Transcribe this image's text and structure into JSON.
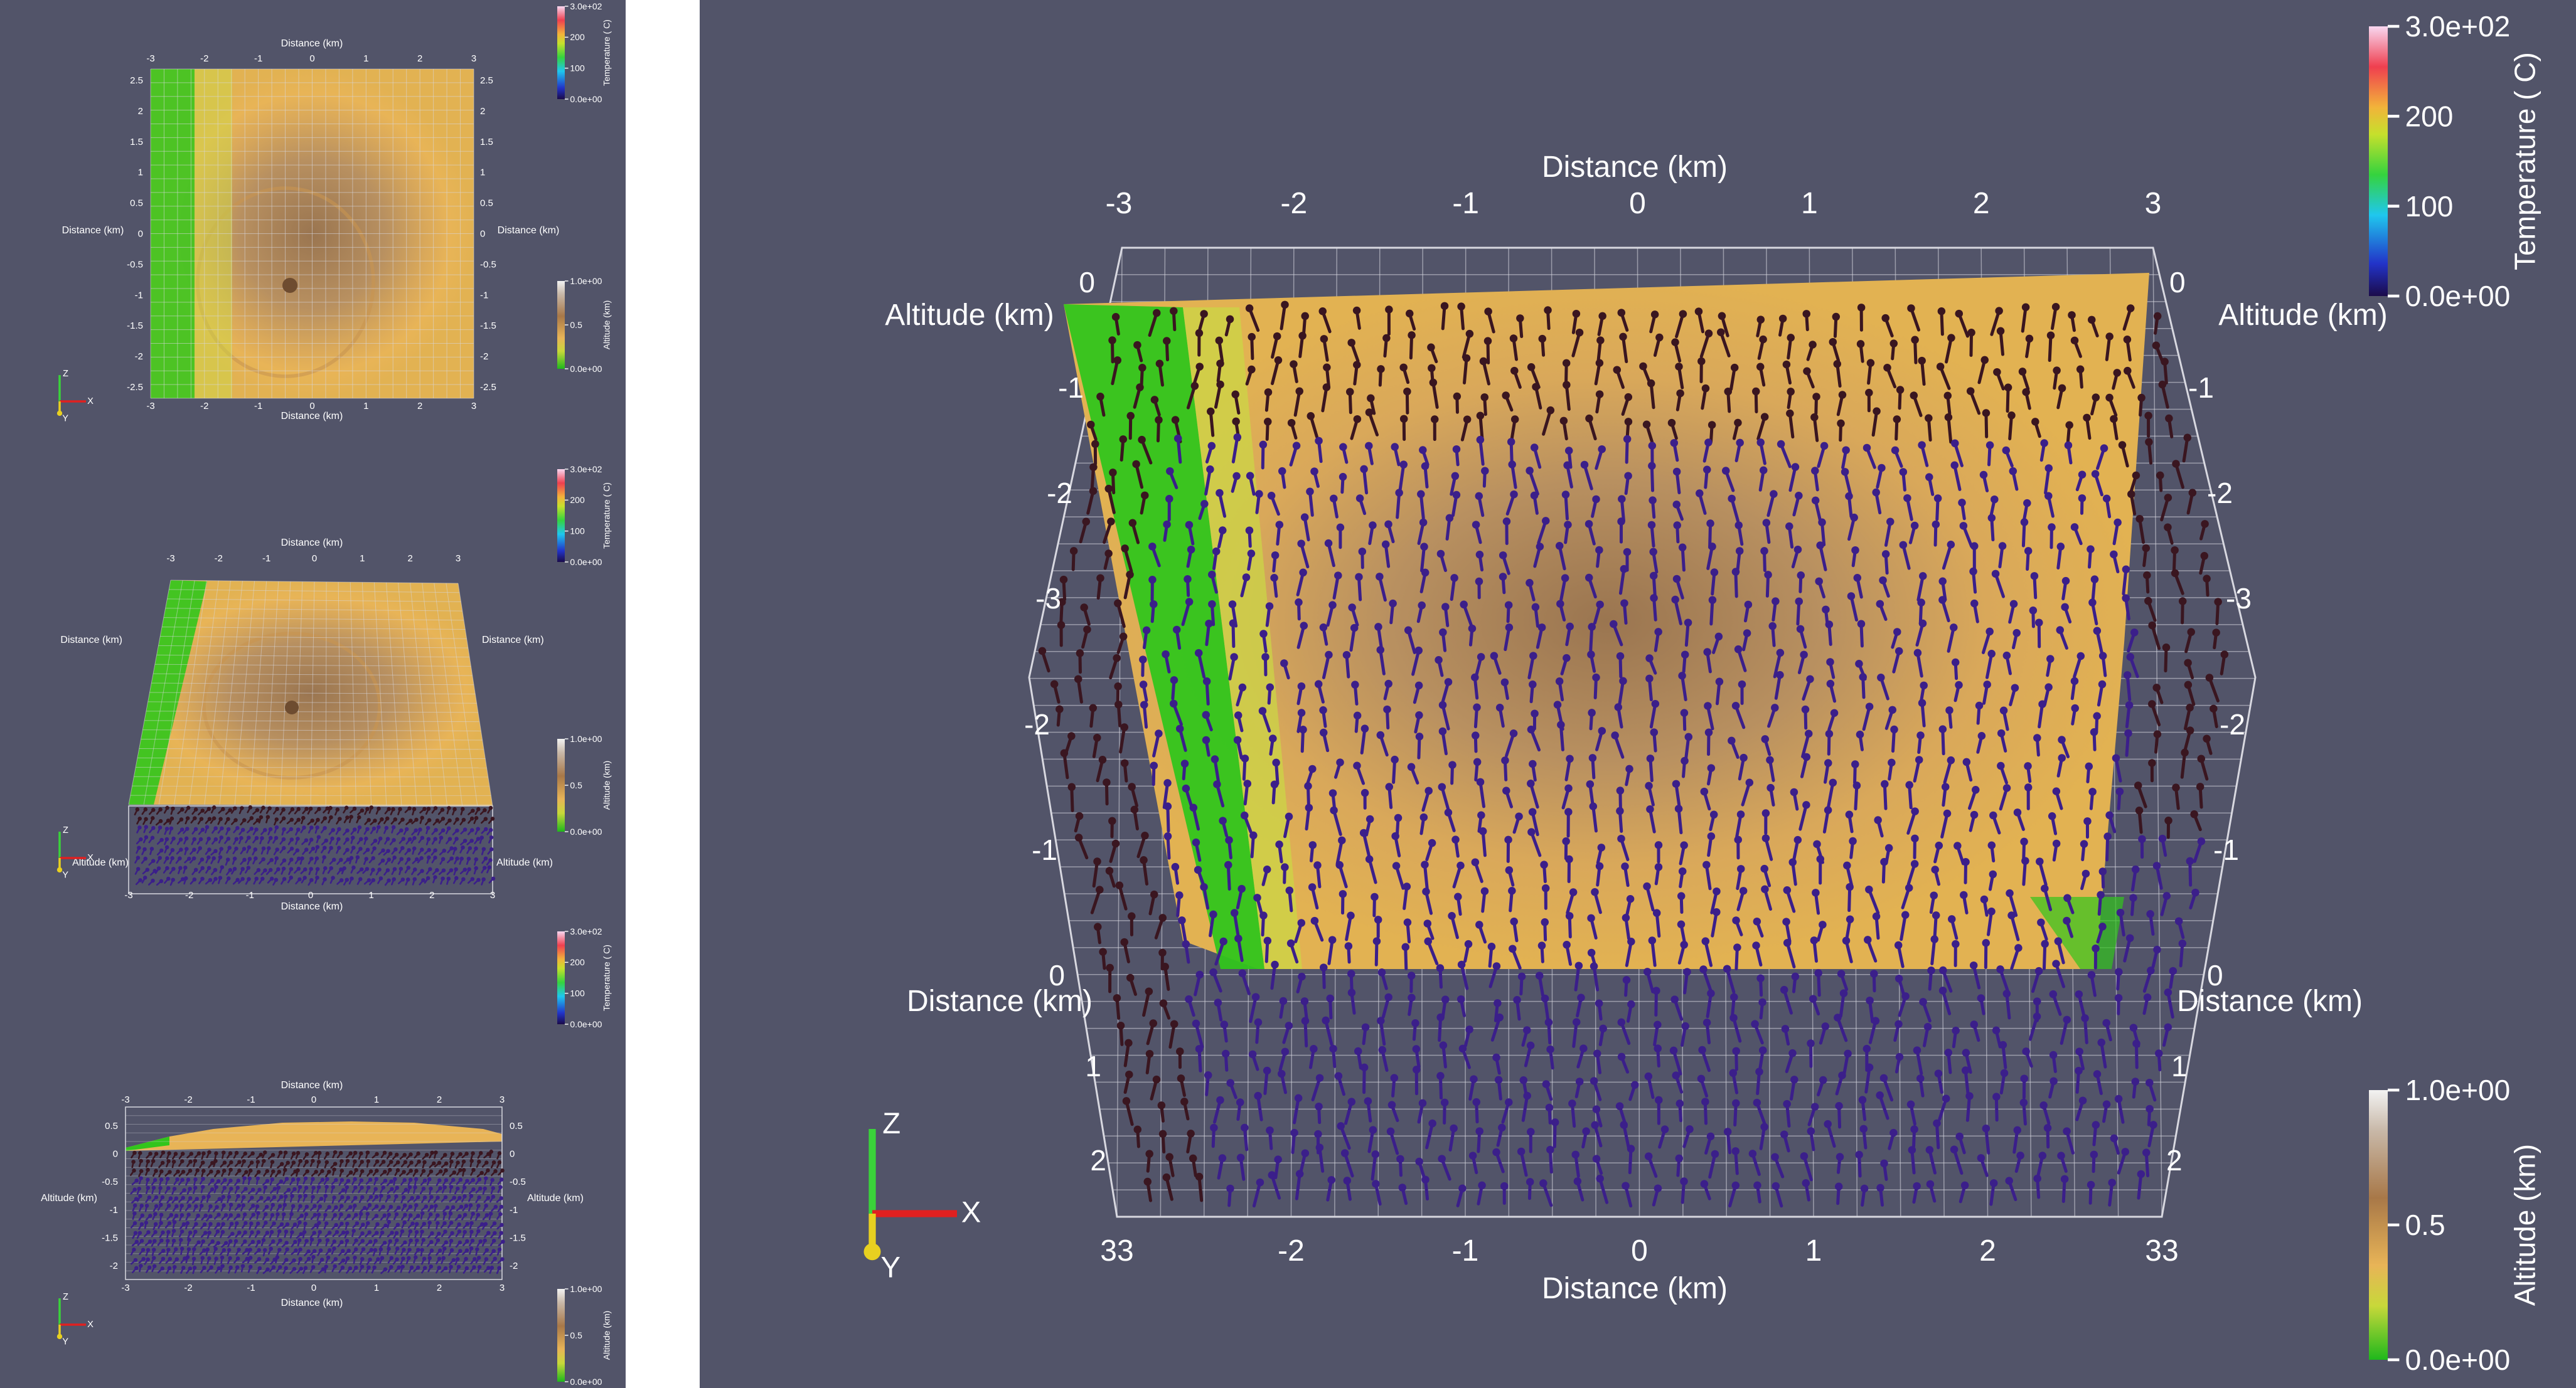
{
  "colors": {
    "background": "#525469",
    "gap": "#ffffff",
    "grid": "#d8d8e0",
    "arrow_deep": "#3b1f8a",
    "arrow_shallow": "#3a1620",
    "terrain_low": "#32c51c",
    "terrain_mid": "#e8b457",
    "terrain_high": "#8f6a47"
  },
  "temperature_bar": {
    "title": "Temperature ( C)",
    "max": "3.0e+02",
    "mid_hi": "200",
    "mid_lo": "100",
    "min": "0.0e+00",
    "range": [
      0,
      300
    ]
  },
  "altitude_bar": {
    "title": "Altitude (km)",
    "max": "1.0e+00",
    "mid": "0.5",
    "min": "0.0e+00",
    "range": [
      0,
      1
    ]
  },
  "axes": {
    "distance_title": "Distance (km)",
    "altitude_title": "Altitude (km)",
    "distance_ticks": [
      "-3",
      "-2",
      "-1",
      "0",
      "1",
      "2",
      "3"
    ],
    "left_view1_y_ticks": [
      "2.5",
      "2",
      "1.5",
      "1",
      "0.5",
      "0",
      "-0.5",
      "-1",
      "-1.5",
      "-2",
      "-2.5"
    ],
    "left_view3_z_ticks": [
      "0.5",
      "0",
      "-0.5",
      "-1",
      "-1.5",
      "-2"
    ],
    "main_top_depth_ticks": [
      "0",
      "-1",
      "-2",
      "-3"
    ],
    "main_mid_depth_ticks": [
      "-2",
      "-1",
      "0"
    ],
    "main_low_depth_ticks": [
      "1",
      "2"
    ],
    "main_bottom_ticks": [
      "33",
      "-2",
      "-1",
      "0",
      "1",
      "2",
      "33"
    ]
  },
  "orientation": {
    "x": "X",
    "y": "Y",
    "z": "Z"
  }
}
